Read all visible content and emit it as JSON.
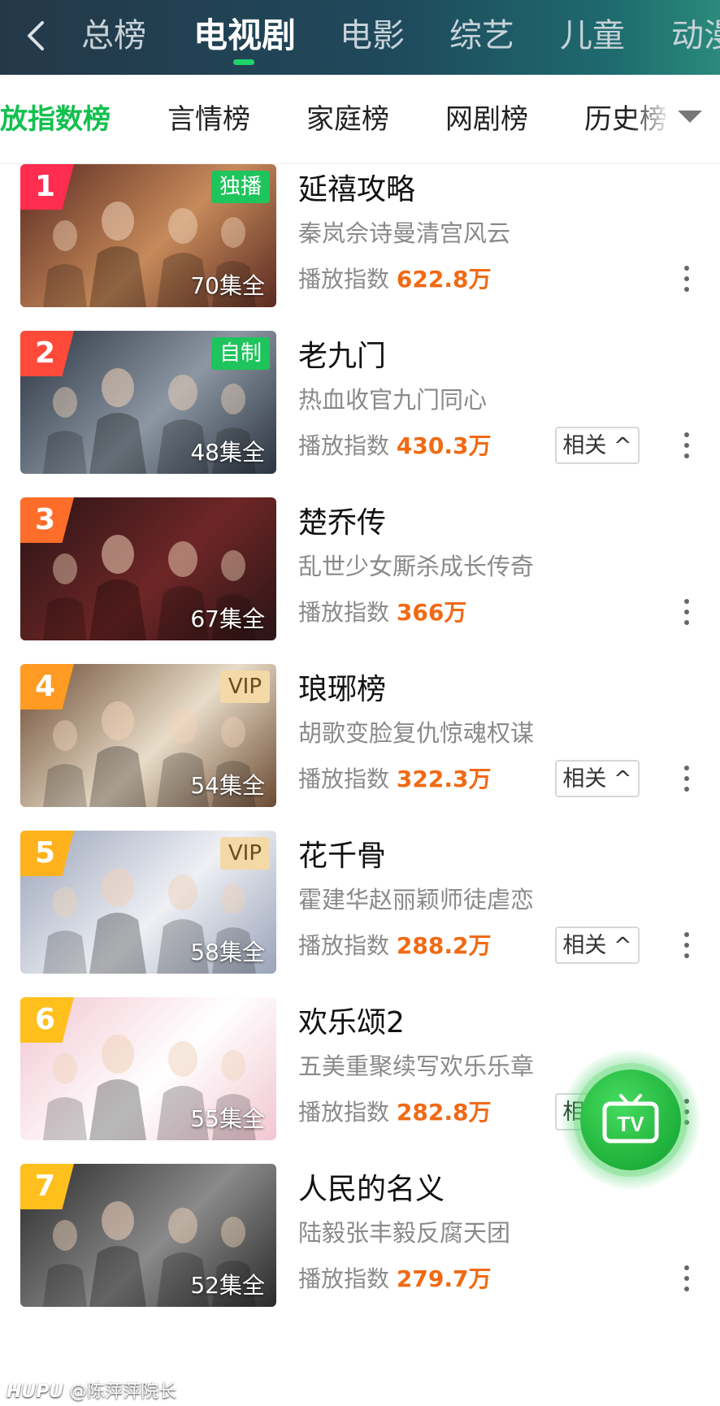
{
  "nav": {
    "tabs": [
      "总榜",
      "电视剧",
      "电影",
      "综艺",
      "儿童",
      "动漫"
    ],
    "active_index": 1
  },
  "subnav": {
    "tabs": [
      "放指数榜",
      "言情榜",
      "家庭榜",
      "网剧榜",
      "历史榜"
    ]
  },
  "stat_label": "播放指数",
  "related_label": "相关 ^",
  "items": [
    {
      "rank": "1",
      "title": "延禧攻略",
      "desc": "秦岚佘诗曼清宫风云",
      "index": "622.8万",
      "episodes": "70集全",
      "badge": "独播",
      "rank_color": "#ff2d4f",
      "poster_colors": [
        "#5b2a22",
        "#c68a5a"
      ]
    },
    {
      "rank": "2",
      "title": "老九门",
      "desc": "热血收官九门同心",
      "index": "430.3万",
      "episodes": "48集全",
      "badge": "自制",
      "rank_color": "#ff4a3a",
      "poster_colors": [
        "#2b3440",
        "#8c97a3"
      ]
    },
    {
      "rank": "3",
      "title": "楚乔传",
      "desc": "乱世少女厮杀成长传奇",
      "index": "366万",
      "episodes": "67集全",
      "badge": "",
      "rank_color": "#ff6d2a",
      "poster_colors": [
        "#2a1416",
        "#6e2626"
      ]
    },
    {
      "rank": "4",
      "title": "琅琊榜",
      "desc": "胡歌变脸复仇惊魂权谋",
      "index": "322.3万",
      "episodes": "54集全",
      "badge": "VIP",
      "rank_color": "#ff9a22",
      "poster_colors": [
        "#6b4a33",
        "#e8dcc8"
      ]
    },
    {
      "rank": "5",
      "title": "花千骨",
      "desc": "霍建华赵丽颖师徒虐恋",
      "index": "288.2万",
      "episodes": "58集全",
      "badge": "VIP",
      "rank_color": "#ffb21e",
      "poster_colors": [
        "#9aa3b8",
        "#eef0f5"
      ]
    },
    {
      "rank": "6",
      "title": "欢乐颂2",
      "desc": "五美重聚续写欢乐乐章",
      "index": "282.8万",
      "episodes": "55集全",
      "badge": "",
      "rank_color": "#ffc01e",
      "poster_colors": [
        "#f2c6d2",
        "#ffffff"
      ]
    },
    {
      "rank": "7",
      "title": "人民的名义",
      "desc": "陆毅张丰毅反腐天团",
      "index": "279.7万",
      "episodes": "52集全",
      "badge": "",
      "rank_color": "#ffc01e",
      "poster_colors": [
        "#2a2a2a",
        "#8a8a8a"
      ]
    }
  ],
  "fab": {
    "label": "TV"
  },
  "footer": {
    "brand": "HUPU",
    "text": "@陈萍萍院长"
  },
  "colors": {
    "accent": "#12c04f",
    "index": "#f06a14"
  }
}
